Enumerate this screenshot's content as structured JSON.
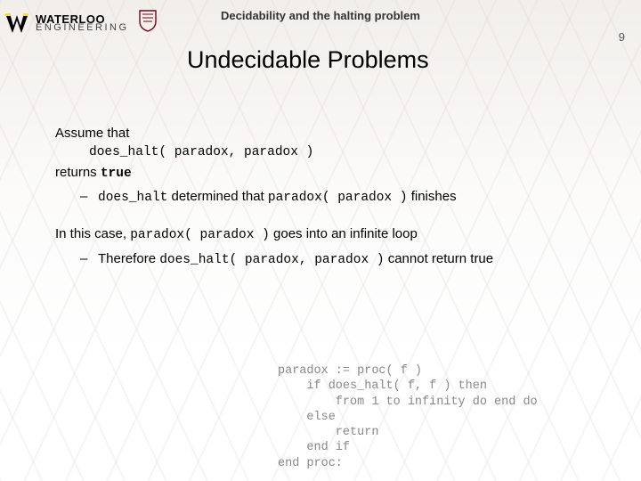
{
  "header": {
    "logo_top": "WATERLOO",
    "logo_bottom": "ENGINEERING",
    "topic": "Decidability and the halting problem",
    "page_number": "9"
  },
  "title": "Undecidable Problems",
  "body": {
    "assume": "Assume that",
    "call": "does_halt( paradox, paradox  )",
    "returns_prefix": "returns ",
    "returns_value": "true",
    "bullet1_a": "does_halt",
    "bullet1_b": " determined that ",
    "bullet1_c": "paradox( paradox )",
    "bullet1_d": " finishes",
    "case_a": "In this case, ",
    "case_b": "paradox( paradox )",
    "case_c": " goes into an infinite loop",
    "bullet2_a": "Therefore ",
    "bullet2_b": "does_halt( paradox, paradox )",
    "bullet2_c": " cannot return true"
  },
  "code": "paradox := proc( f )\n    if does_halt( f, f ) then\n        from 1 to infinity do end do\n    else\n        return\n    end if\nend proc:"
}
